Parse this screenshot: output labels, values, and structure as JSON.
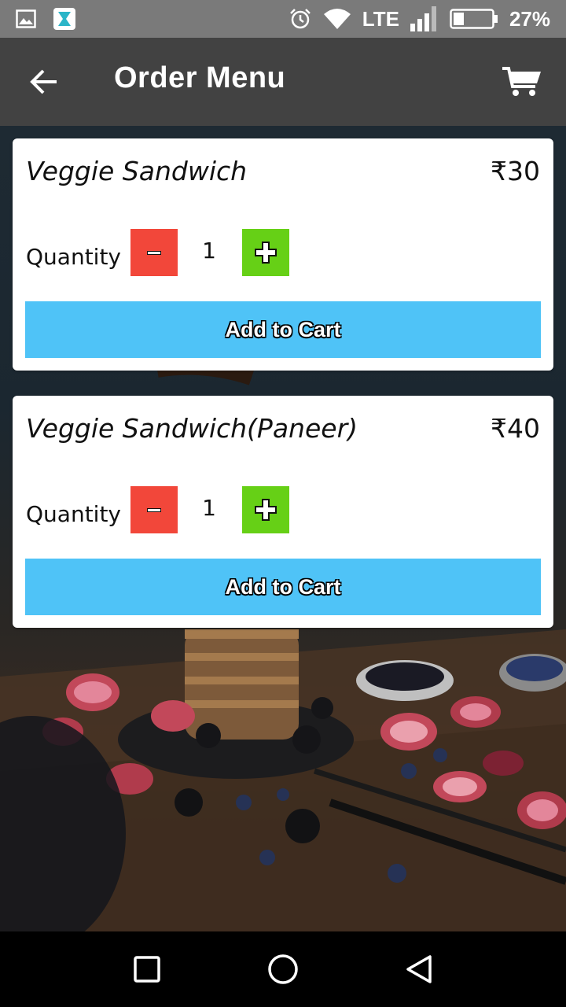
{
  "status_bar": {
    "network_label": "LTE",
    "battery_percent": "27%",
    "icons": [
      "gallery-icon",
      "app-icon",
      "alarm-icon",
      "wifi-icon",
      "signal-icon",
      "battery-icon"
    ]
  },
  "app_bar": {
    "title": "Order Menu",
    "back_icon": "arrow-left-icon",
    "cart_icon": "cart-icon"
  },
  "items": [
    {
      "name": "Veggie Sandwich",
      "price": "₹30",
      "quantity_label": "Quantity",
      "quantity": "1",
      "minus_label": "-",
      "plus_label": "+",
      "add_label": "Add to Cart"
    },
    {
      "name": "Veggie Sandwich(Paneer)",
      "price": "₹40",
      "quantity_label": "Quantity",
      "quantity": "1",
      "minus_label": "-",
      "plus_label": "+",
      "add_label": "Add to Cart"
    }
  ],
  "nav_bar": {
    "icons": [
      "recents-square-icon",
      "home-circle-icon",
      "back-triangle-icon"
    ]
  },
  "colors": {
    "status_bar": "#7a7a7a",
    "app_bar": "#424242",
    "minus_button": "#f2473a",
    "plus_button": "#66d016",
    "add_to_cart": "#4fc3f7"
  }
}
